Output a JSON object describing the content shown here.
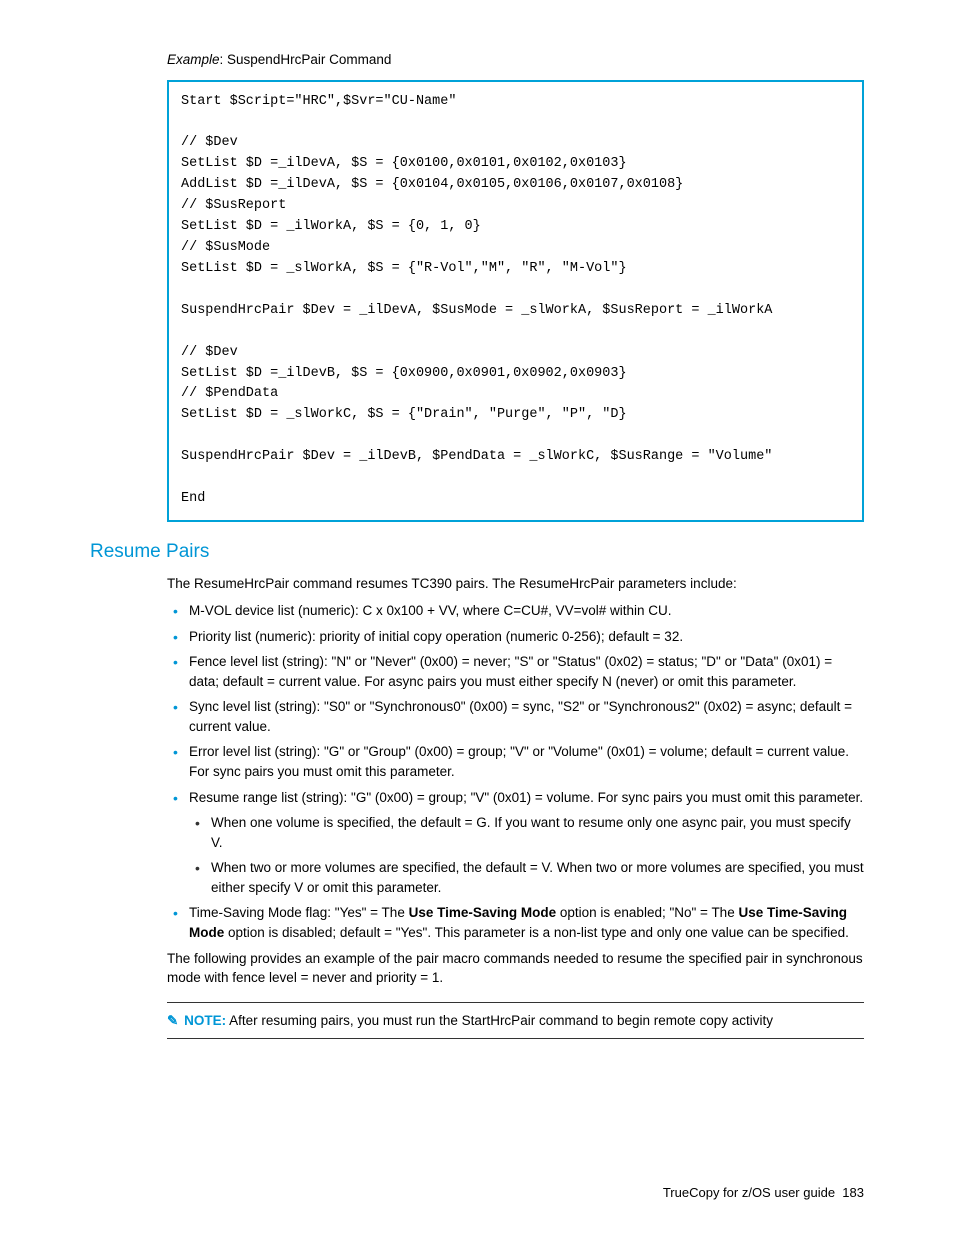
{
  "example": {
    "label_italic": "Example",
    "label_rest": ": SuspendHrcPair Command",
    "code": "Start $Script=\"HRC\",$Svr=\"CU-Name\"\n\n// $Dev\nSetList $D =_ilDevA, $S = {0x0100,0x0101,0x0102,0x0103}\nAddList $D =_ilDevA, $S = {0x0104,0x0105,0x0106,0x0107,0x0108}\n// $SusReport\nSetList $D = _ilWorkA, $S = {0, 1, 0}\n// $SusMode\nSetList $D = _slWorkA, $S = {\"R-Vol\",\"M\", \"R\", \"M-Vol\"}\n\nSuspendHrcPair $Dev = _ilDevA, $SusMode = _slWorkA, $SusReport = _ilWorkA\n\n// $Dev\nSetList $D =_ilDevB, $S = {0x0900,0x0901,0x0902,0x0903}\n// $PendData\nSetList $D = _slWorkC, $S = {\"Drain\", \"Purge\", \"P\", \"D}\n\nSuspendHrcPair $Dev = _ilDevB, $PendData = _slWorkC, $SusRange = \"Volume\"\n\nEnd"
  },
  "section": {
    "heading": "Resume Pairs",
    "intro": "The ResumeHrcPair command resumes TC390 pairs. The ResumeHrcPair parameters include:",
    "bullets": {
      "b0": "M-VOL device list (numeric): C x 0x100 + VV, where C=CU#, VV=vol# within CU.",
      "b1": "Priority list (numeric): priority of initial copy operation (numeric 0-256); default = 32.",
      "b2": "Fence level list (string): \"N\" or \"Never\" (0x00) = never; \"S\" or \"Status\" (0x02) = status; \"D\" or \"Data\" (0x01) = data; default = current value. For async pairs you must either specify N (never) or omit this parameter.",
      "b3": "Sync level list (string): \"S0\" or \"Synchronous0\" (0x00) = sync, \"S2\" or \"Synchronous2\" (0x02) = async; default = current value.",
      "b4": "Error level list (string): \"G\" or \"Group\" (0x00) = group; \"V\" or \"Volume\" (0x01) = volume; default = current value. For sync pairs you must omit this parameter.",
      "b5": "Resume range list (string): \"G\" (0x00) = group; \"V\" (0x01) = volume. For sync pairs you must omit this parameter.",
      "b5_sub0": "When one volume is specified, the default = G. If you want to resume only one async pair, you must specify V.",
      "b5_sub1": "When two or more volumes are specified, the default = V. When two or more volumes are specified, you must either specify V or omit this parameter.",
      "b6_pre": "Time-Saving Mode flag: \"Yes\" = The ",
      "b6_bold1": "Use Time-Saving Mode",
      "b6_mid": " option is enabled; \"No\" = The ",
      "b6_bold2": "Use Time-Saving Mode",
      "b6_post": " option is disabled; default = \"Yes\". This parameter is a non-list type and only one value can be specified."
    },
    "following": "The following provides an example of the pair macro commands needed to resume the specified pair in synchronous mode with fence level = never and priority = 1."
  },
  "note": {
    "label": "NOTE:",
    "text": "   After resuming pairs, you must run the StartHrcPair command to begin remote copy activity"
  },
  "footer": {
    "title": "TrueCopy for z/OS user guide",
    "page": "183"
  }
}
